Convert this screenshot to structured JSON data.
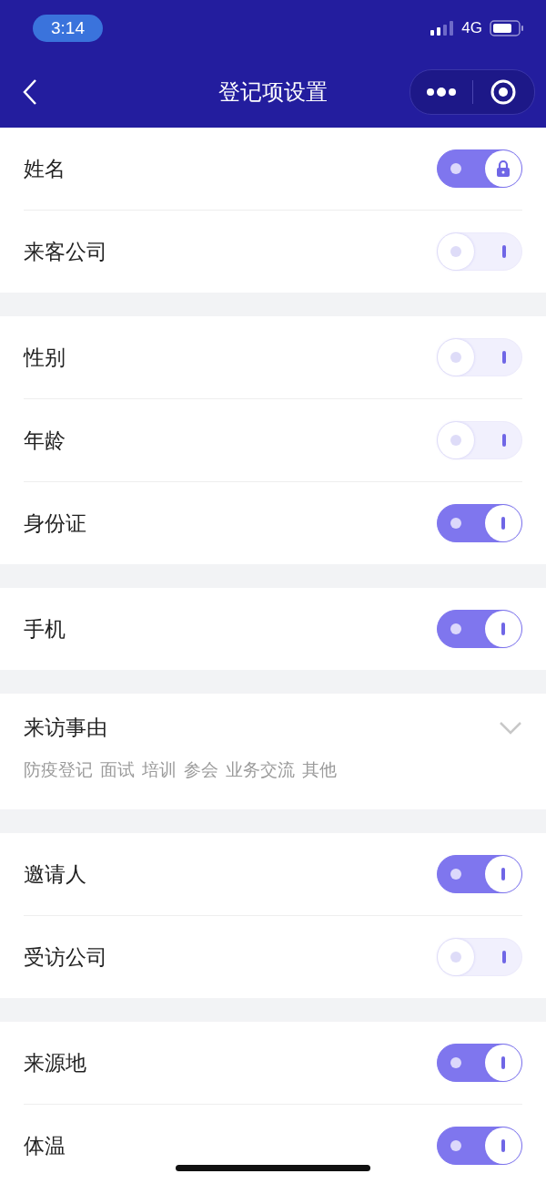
{
  "status_bar": {
    "time": "3:14",
    "network": "4G"
  },
  "nav": {
    "title": "登记项设置"
  },
  "groups": [
    {
      "items": [
        {
          "kind": "toggle",
          "label": "姓名",
          "on": true,
          "locked": true
        },
        {
          "kind": "toggle",
          "label": "来客公司",
          "on": false,
          "locked": false
        }
      ]
    },
    {
      "items": [
        {
          "kind": "toggle",
          "label": "性别",
          "on": false,
          "locked": false
        },
        {
          "kind": "toggle",
          "label": "年龄",
          "on": false,
          "locked": false
        },
        {
          "kind": "toggle",
          "label": "身份证",
          "on": true,
          "locked": false
        }
      ]
    },
    {
      "items": [
        {
          "kind": "toggle",
          "label": "手机",
          "on": true,
          "locked": false
        }
      ]
    },
    {
      "items": [
        {
          "kind": "select",
          "label": "来访事由",
          "options": [
            "防疫登记",
            "面试",
            "培训",
            "参会",
            "业务交流",
            "其他"
          ]
        }
      ]
    },
    {
      "items": [
        {
          "kind": "toggle",
          "label": "邀请人",
          "on": true,
          "locked": false
        },
        {
          "kind": "toggle",
          "label": "受访公司",
          "on": false,
          "locked": false
        }
      ]
    },
    {
      "items": [
        {
          "kind": "toggle",
          "label": "来源地",
          "on": true,
          "locked": false
        },
        {
          "kind": "toggle",
          "label": "体温",
          "on": true,
          "locked": false
        }
      ]
    }
  ]
}
